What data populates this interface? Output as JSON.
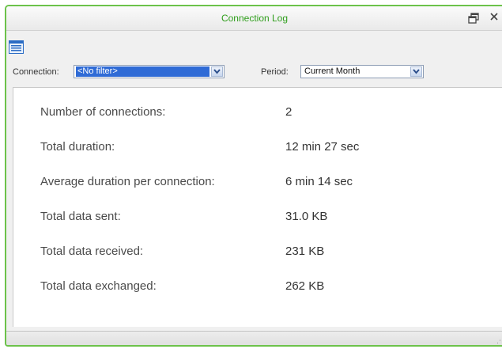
{
  "window": {
    "title": "Connection Log"
  },
  "toolbar": {
    "list_icon": "list-view-icon"
  },
  "filters": {
    "connection_label": "Connection:",
    "connection_value": "<No filter>",
    "period_label": "Period:",
    "period_value": "Current Month"
  },
  "stats": [
    {
      "label": "Number of connections:",
      "value": "2"
    },
    {
      "label": "Total duration:",
      "value": "12 min 27 sec"
    },
    {
      "label": "Average duration per connection:",
      "value": "6 min 14 sec"
    },
    {
      "label": "Total data sent:",
      "value": "31.0 KB"
    },
    {
      "label": "Total data received:",
      "value": "231 KB"
    },
    {
      "label": "Total data exchanged:",
      "value": "262 KB"
    }
  ],
  "colors": {
    "border": "#6cc24a",
    "title": "#2f9e1c",
    "selection": "#2f6bd6"
  }
}
